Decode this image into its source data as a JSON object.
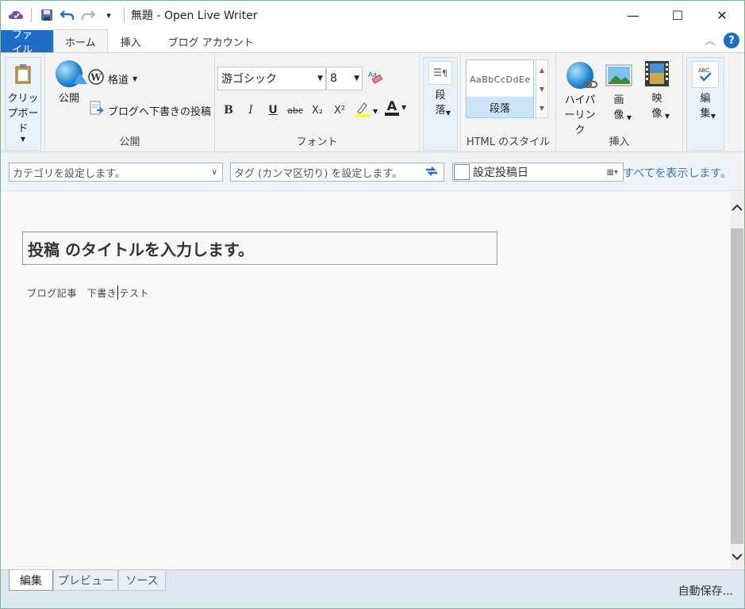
{
  "window": {
    "title": "無題 - Open Live Writer",
    "controls": {
      "minimize": "—",
      "maximize": "☐",
      "close": "✕"
    }
  },
  "qat": {
    "customize": "▾"
  },
  "tabs": [
    {
      "label": "ファイル"
    },
    {
      "label": "ホーム"
    },
    {
      "label": "挿入"
    },
    {
      "label": "ブログ アカウント"
    }
  ],
  "tabs_right": {
    "collapse": "︿",
    "help": "?"
  },
  "ribbon": {
    "clipboard": {
      "label": "クリップボード"
    },
    "publish_group": {
      "publish": "公開",
      "blog": "格道",
      "draft": "ブログへ下書きの投稿",
      "group_label": "公開"
    },
    "font": {
      "family": "游ゴシック",
      "size": "8",
      "bold": "B",
      "italic": "I",
      "underline": "U",
      "strike": "abc",
      "subscript": "X₂",
      "superscript": "X²",
      "color_letter": "A",
      "group_label": "フォント"
    },
    "paragraph": {
      "label": "段落"
    },
    "html_style": {
      "preview": "AaBbCcDdEe",
      "label": "段落",
      "group_label": "HTML のスタイル"
    },
    "insert": {
      "hyperlink": "ハイパーリンク",
      "image": "画像",
      "video": "映像",
      "group_label": "挿入"
    },
    "edit": {
      "label": "編集"
    }
  },
  "propbar": {
    "category_placeholder": "カテゴリを設定します。",
    "tags_placeholder": "タグ (カンマ区切り) を設定します。",
    "date_label": "設定投稿日",
    "show_all": "すべてを表示します。"
  },
  "editor": {
    "title_placeholder": "投稿 のタイトルを入力します。",
    "body_before_caret": "ブログ記事　下書き",
    "body_after_caret": "テスト"
  },
  "bottom": {
    "tabs": [
      "編集",
      "プレビュー",
      "ソース"
    ],
    "status": "自動保存..."
  },
  "colors": {
    "accent": "#1e6ec6",
    "link": "#3a78c2",
    "highlight": "#ffff00"
  }
}
